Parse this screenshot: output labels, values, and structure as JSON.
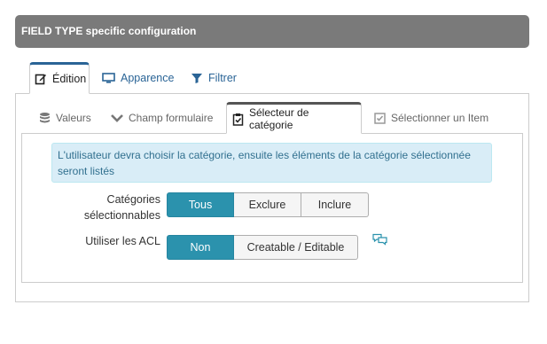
{
  "header": {
    "title": "FIELD TYPE specific configuration"
  },
  "outer_tabs": [
    {
      "label": "Édition",
      "icon": "edit-icon"
    },
    {
      "label": "Apparence",
      "icon": "monitor-icon"
    },
    {
      "label": "Filtrer",
      "icon": "filter-icon"
    }
  ],
  "inner_tabs": [
    {
      "label": "Valeurs",
      "icon": "database-icon"
    },
    {
      "label": "Champ formulaire",
      "icon": "chevron-down-icon"
    },
    {
      "label": "Sélecteur de catégorie",
      "icon": "clipboard-check-icon"
    },
    {
      "label": "Sélectionner un Item",
      "icon": "checkbox-icon"
    }
  ],
  "info": {
    "text": "L'utilisateur devra choisir la catégorie, ensuite les éléments de la catégorie sélectionnée seront listés"
  },
  "categories_field": {
    "label": "Catégories sélectionnables",
    "options": [
      "Tous",
      "Exclure",
      "Inclure"
    ],
    "selected": "Tous"
  },
  "acl_field": {
    "label": "Utiliser les ACL",
    "options": [
      "Non",
      "Creatable / Editable"
    ],
    "selected": "Non",
    "help_icon": "comments-icon"
  },
  "colors": {
    "accent": "#2b92ad",
    "header_bg": "#7a7a7a",
    "link": "#2a6496",
    "info_bg": "#d9edf7"
  }
}
